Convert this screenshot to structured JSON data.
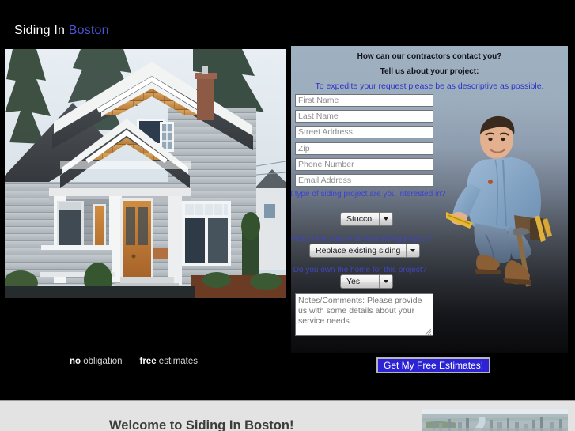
{
  "header": {
    "title_primary": "Siding In ",
    "title_accent": "Boston"
  },
  "hero": {
    "house_photo_alt": "two-story gray sided craftsman house with cedar shake gables and wood front door"
  },
  "form": {
    "heading_1": "How can our contractors contact you?",
    "heading_2": "Tell us about your project:",
    "heading_3": "To expedite your request please be as descriptive as possible.",
    "fields": [
      {
        "name": "first-name",
        "placeholder": "First Name",
        "value": ""
      },
      {
        "name": "last-name",
        "placeholder": "Last Name",
        "value": ""
      },
      {
        "name": "street-address",
        "placeholder": "Street Address",
        "value": ""
      },
      {
        "name": "zip",
        "placeholder": "Zip",
        "value": ""
      },
      {
        "name": "phone-number",
        "placeholder": "Phone Number",
        "value": ""
      },
      {
        "name": "email-address",
        "placeholder": "Email Address",
        "value": ""
      }
    ],
    "question_1": "What type of siding project are you interested in?",
    "select_1_value": "Stucco",
    "question_2": "What is the nature of your siding project?",
    "select_2_value": "Replace existing siding",
    "question_3": "Do you own the home for this project?",
    "select_3_value": "Yes",
    "notes_placeholder": "Notes/Comments: Please provide us with some details about your service needs.",
    "notes_value": "",
    "contractor_photo_alt": "contractor crouching in blue denim shirt with tool belt"
  },
  "tagline": {
    "bold_1": "no",
    "text_1": " obligation",
    "bold_2": "free",
    "text_2": " estimates"
  },
  "submit": {
    "label": "Get My Free Estimates!"
  },
  "bottom": {
    "welcome_title": "Welcome to Siding In Boston!",
    "city_photo_alt": "aerial view of a city skyline with a river"
  },
  "colors": {
    "accent_blue": "#4a55d8",
    "question_blue": "#3b43d2",
    "submit_blue": "#2b23d4",
    "panel_top": "#9fb0c1",
    "page_background": "#000000",
    "bottom_band": "#e3e3e3"
  }
}
